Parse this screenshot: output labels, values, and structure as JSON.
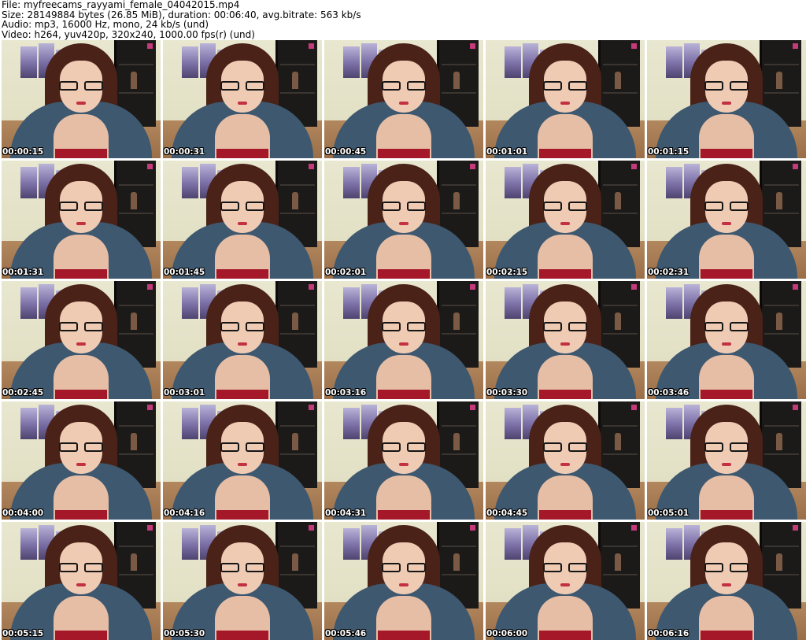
{
  "header": {
    "file_line": "File: myfreecams_rayyami_female_04042015.mp4",
    "size_line": "Size: 28149884 bytes (26.85 MiB), duration: 00:06:40, avg.bitrate: 563 kb/s",
    "audio_line": "Audio: mp3, 16000 Hz, mono, 24 kb/s (und)",
    "video_line": "Video: h264, yuv420p, 320x240, 1000.00 fps(r) (und)"
  },
  "thumbnails": [
    {
      "timestamp": "00:00:15"
    },
    {
      "timestamp": "00:00:31"
    },
    {
      "timestamp": "00:00:45"
    },
    {
      "timestamp": "00:01:01"
    },
    {
      "timestamp": "00:01:15"
    },
    {
      "timestamp": "00:01:31"
    },
    {
      "timestamp": "00:01:45"
    },
    {
      "timestamp": "00:02:01"
    },
    {
      "timestamp": "00:02:15"
    },
    {
      "timestamp": "00:02:31"
    },
    {
      "timestamp": "00:02:45"
    },
    {
      "timestamp": "00:03:01"
    },
    {
      "timestamp": "00:03:16"
    },
    {
      "timestamp": "00:03:30"
    },
    {
      "timestamp": "00:03:46"
    },
    {
      "timestamp": "00:04:00"
    },
    {
      "timestamp": "00:04:16"
    },
    {
      "timestamp": "00:04:31"
    },
    {
      "timestamp": "00:04:45"
    },
    {
      "timestamp": "00:05:01"
    },
    {
      "timestamp": "00:05:15"
    },
    {
      "timestamp": "00:05:30"
    },
    {
      "timestamp": "00:05:46"
    },
    {
      "timestamp": "00:06:00"
    },
    {
      "timestamp": "00:06:16"
    }
  ]
}
